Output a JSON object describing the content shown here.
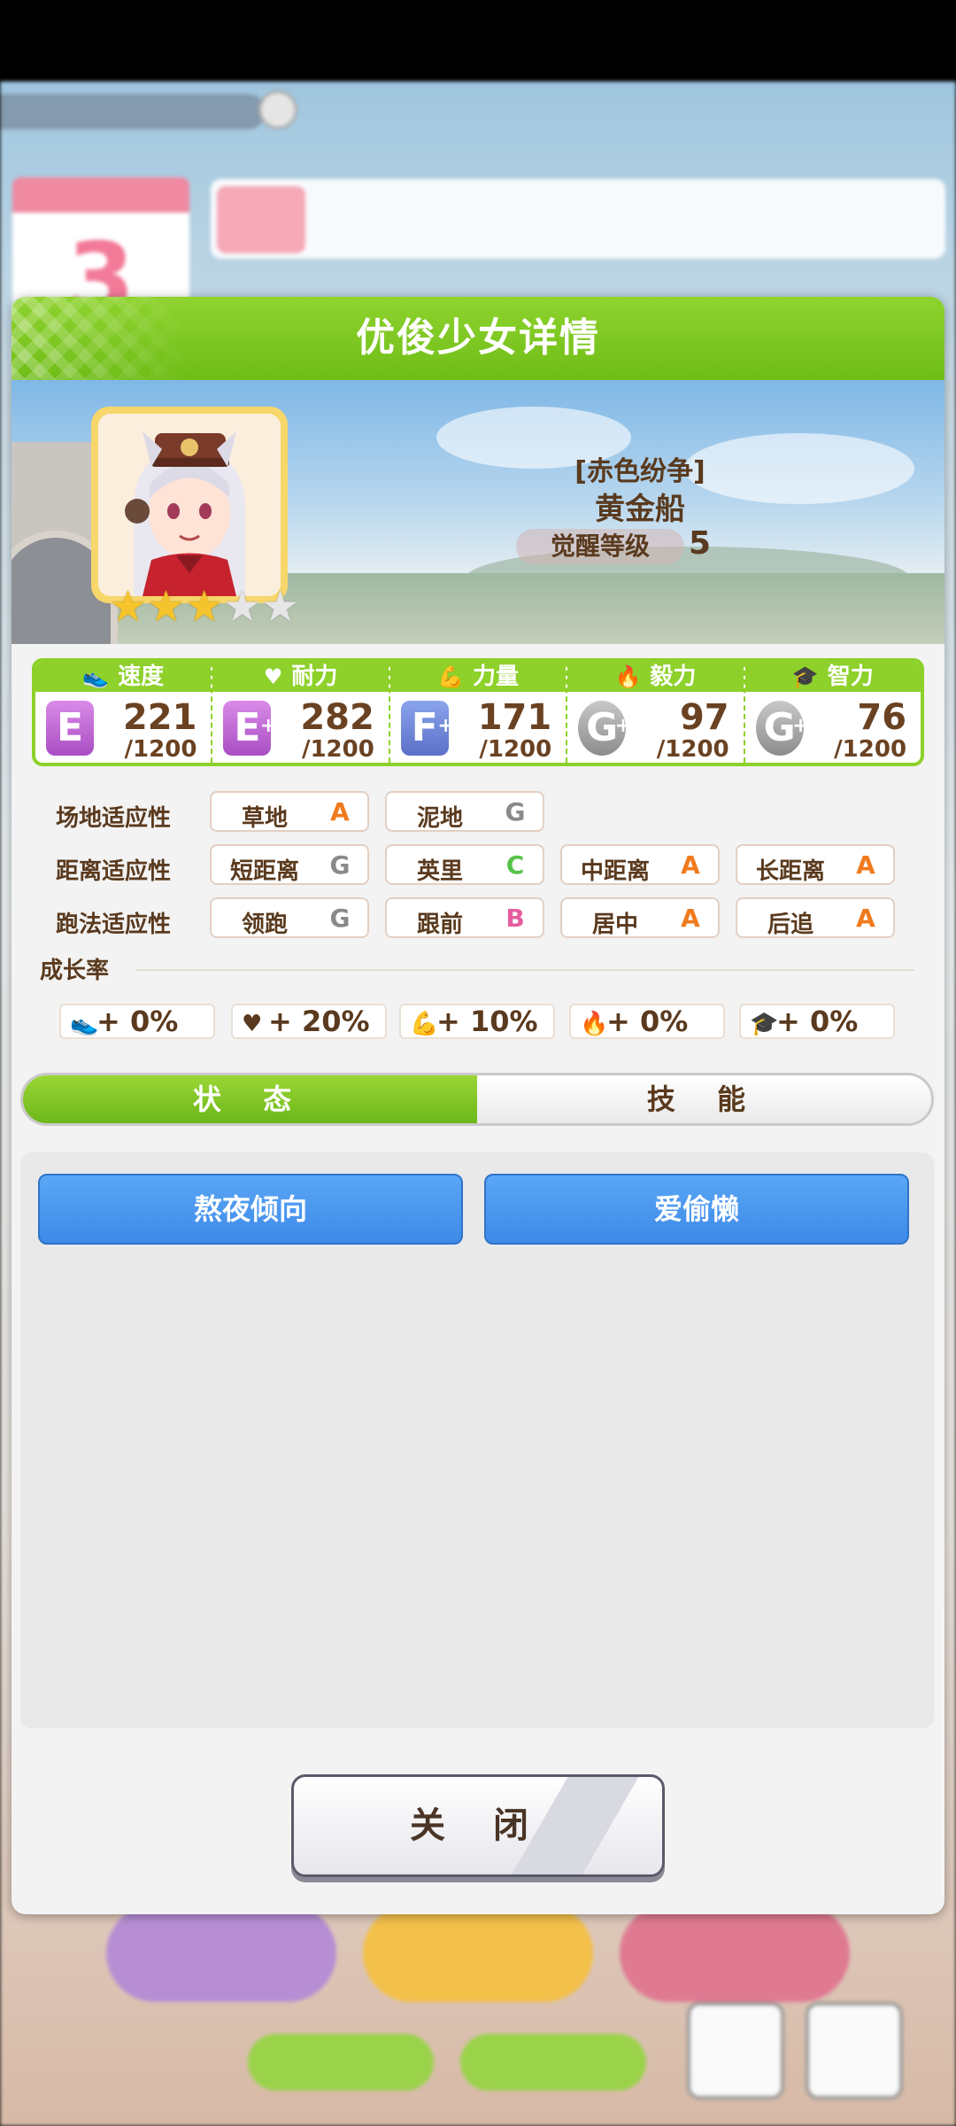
{
  "dialog": {
    "title": "优俊少女详情",
    "epithet": "[赤色纷争]",
    "name": "黄金船",
    "awakening_label": "觉醒等级",
    "awakening_level": "5",
    "rarity_stars": 3,
    "rarity_max": 5
  },
  "stats": [
    {
      "label": "速度",
      "icon": "shoe-icon",
      "grade": "E",
      "plus": false,
      "value": "221",
      "max": "/1200"
    },
    {
      "label": "耐力",
      "icon": "heart-icon",
      "grade": "E",
      "plus": true,
      "value": "282",
      "max": "/1200"
    },
    {
      "label": "力量",
      "icon": "muscle-icon",
      "grade": "F",
      "plus": true,
      "value": "171",
      "max": "/1200"
    },
    {
      "label": "毅力",
      "icon": "flame-icon",
      "grade": "G",
      "plus": true,
      "value": "97",
      "max": "/1200"
    },
    {
      "label": "智力",
      "icon": "graduation-cap-icon",
      "grade": "G",
      "plus": true,
      "value": "76",
      "max": "/1200"
    }
  ],
  "aptitude": {
    "track": {
      "label": "场地适应性",
      "items": [
        {
          "name": "草地",
          "rank": "A"
        },
        {
          "name": "泥地",
          "rank": "G"
        }
      ]
    },
    "distance": {
      "label": "距离适应性",
      "items": [
        {
          "name": "短距离",
          "rank": "G"
        },
        {
          "name": "英里",
          "rank": "C"
        },
        {
          "name": "中距离",
          "rank": "A"
        },
        {
          "name": "长距离",
          "rank": "A"
        }
      ]
    },
    "style": {
      "label": "跑法适应性",
      "items": [
        {
          "name": "领跑",
          "rank": "G"
        },
        {
          "name": "跟前",
          "rank": "B"
        },
        {
          "name": "居中",
          "rank": "A"
        },
        {
          "name": "后追",
          "rank": "A"
        }
      ]
    }
  },
  "growth": {
    "title": "成长率",
    "items": [
      "+ 0%",
      "+ 20%",
      "+ 10%",
      "+ 0%",
      "+ 0%"
    ]
  },
  "tabs": {
    "status": "状 态",
    "skills": "技 能"
  },
  "status_tags": [
    "熬夜倾向",
    "爱偷懒"
  ],
  "close_label": "关 闭"
}
